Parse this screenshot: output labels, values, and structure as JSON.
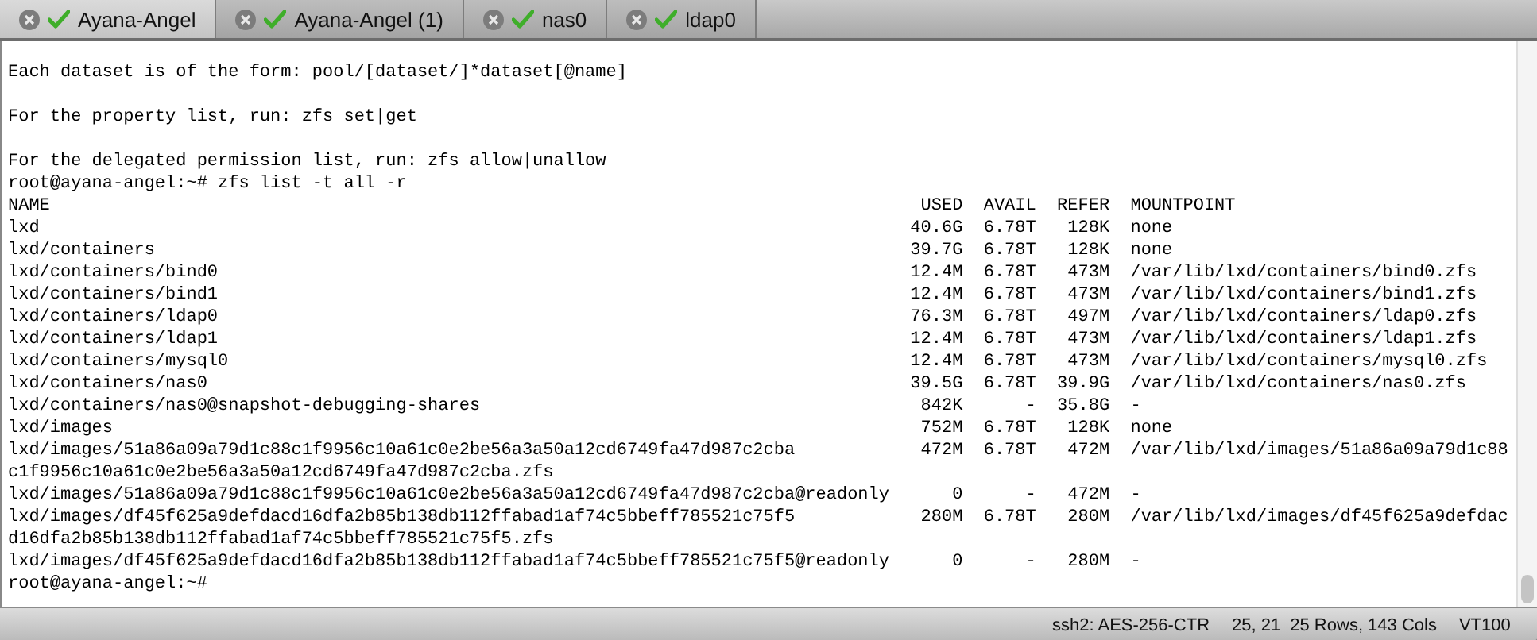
{
  "tabs": [
    {
      "label": "Ayana-Angel",
      "selected": true
    },
    {
      "label": "Ayana-Angel (1)",
      "selected": false
    },
    {
      "label": "nas0",
      "selected": false
    },
    {
      "label": "ldap0",
      "selected": false
    }
  ],
  "terminal": {
    "lines": [
      {
        "kind": "text",
        "text": "Each dataset is of the form: pool/[dataset/]*dataset[@name]"
      },
      {
        "kind": "blank"
      },
      {
        "kind": "text",
        "text": "For the property list, run: zfs set|get"
      },
      {
        "kind": "blank"
      },
      {
        "kind": "text",
        "text": "For the delegated permission list, run: zfs allow|unallow"
      },
      {
        "kind": "text",
        "text": "root@ayana-angel:~# zfs list -t all -r"
      },
      {
        "kind": "table",
        "columns": [
          "NAME",
          "USED",
          "AVAIL",
          "REFER",
          "MOUNTPOINT"
        ],
        "rows": [
          {
            "cells": [
              "lxd",
              "40.6G",
              "6.78T",
              "128K",
              "none"
            ]
          },
          {
            "cells": [
              "lxd/containers",
              "39.7G",
              "6.78T",
              "128K",
              "none"
            ]
          },
          {
            "cells": [
              "lxd/containers/bind0",
              "12.4M",
              "6.78T",
              "473M",
              "/var/lib/lxd/containers/bind0.zfs"
            ]
          },
          {
            "cells": [
              "lxd/containers/bind1",
              "12.4M",
              "6.78T",
              "473M",
              "/var/lib/lxd/containers/bind1.zfs"
            ]
          },
          {
            "cells": [
              "lxd/containers/ldap0",
              "76.3M",
              "6.78T",
              "497M",
              "/var/lib/lxd/containers/ldap0.zfs"
            ]
          },
          {
            "cells": [
              "lxd/containers/ldap1",
              "12.4M",
              "6.78T",
              "473M",
              "/var/lib/lxd/containers/ldap1.zfs"
            ]
          },
          {
            "cells": [
              "lxd/containers/mysql0",
              "12.4M",
              "6.78T",
              "473M",
              "/var/lib/lxd/containers/mysql0.zfs"
            ]
          },
          {
            "cells": [
              "lxd/containers/nas0",
              "39.5G",
              "6.78T",
              "39.9G",
              "/var/lib/lxd/containers/nas0.zfs"
            ]
          },
          {
            "cells": [
              "lxd/containers/nas0@snapshot-debugging-shares",
              "842K",
              "-",
              "35.8G",
              "-"
            ]
          },
          {
            "cells": [
              "lxd/images",
              "752M",
              "6.78T",
              "128K",
              "none"
            ]
          },
          {
            "cells": [
              "lxd/images/51a86a09a79d1c88c1f9956c10a61c0e2be56a3a50a12cd6749fa47d987c2cba",
              "472M",
              "6.78T",
              "472M",
              "/var/lib/lxd/images/51a86a09a79d1c88"
            ],
            "wrap": "c1f9956c10a61c0e2be56a3a50a12cd6749fa47d987c2cba.zfs"
          },
          {
            "cells": [
              "lxd/images/51a86a09a79d1c88c1f9956c10a61c0e2be56a3a50a12cd6749fa47d987c2cba@readonly",
              "0",
              "-",
              "472M",
              "-"
            ]
          },
          {
            "cells": [
              "lxd/images/df45f625a9defdacd16dfa2b85b138db112ffabad1af74c5bbeff785521c75f5",
              "280M",
              "6.78T",
              "280M",
              "/var/lib/lxd/images/df45f625a9defdac"
            ],
            "wrap": "d16dfa2b85b138db112ffabad1af74c5bbeff785521c75f5.zfs"
          },
          {
            "cells": [
              "lxd/images/df45f625a9defdacd16dfa2b85b138db112ffabad1af74c5bbeff785521c75f5@readonly",
              "0",
              "-",
              "280M",
              "-"
            ]
          }
        ]
      },
      {
        "kind": "text",
        "text": "root@ayana-angel:~#"
      }
    ]
  },
  "status_bar": [
    "ssh2: AES-256-CTR",
    "25, 21",
    "25 Rows, 143 Cols",
    "VT100"
  ]
}
